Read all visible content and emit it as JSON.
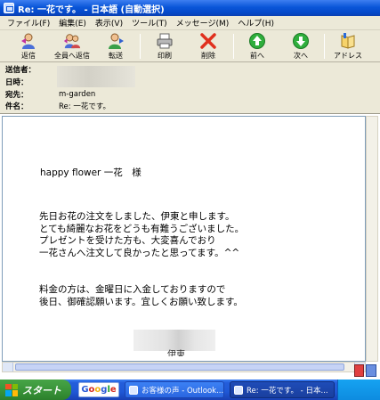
{
  "window": {
    "title": "Re: 一花です。 - 日本語 (自動選択)"
  },
  "menu": [
    {
      "label": "ファイル(F)"
    },
    {
      "label": "編集(E)"
    },
    {
      "label": "表示(V)"
    },
    {
      "label": "ツール(T)"
    },
    {
      "label": "メッセージ(M)"
    },
    {
      "label": "ヘルプ(H)"
    }
  ],
  "toolbar": {
    "reply": "返信",
    "reply_all": "全員へ返信",
    "forward": "転送",
    "print": "印刷",
    "delete": "削除",
    "previous": "前へ",
    "next": "次へ",
    "addresses": "アドレス"
  },
  "headers": {
    "from_label": "送信者：",
    "date_label": "日時：",
    "to_label": "宛先：",
    "to_value": "m-garden",
    "subject_label": "件名：",
    "subject_value": "Re: 一花です。"
  },
  "message": {
    "greeting": "happy flower 一花　様",
    "paragraph1": [
      "先日お花の注文をしました、伊東と申します。",
      "とても綺麗なお花をどうも有難うございました。",
      "プレゼントを受けた方も、大変喜んでおり",
      "一花さんへ注文して良かったと思ってます。^^"
    ],
    "paragraph2": [
      "料金の方は、金曜日に入金しておりますので",
      "後日、御確認願います。宜しくお願い致します。"
    ],
    "signature_partial": "伊東"
  },
  "taskbar": {
    "start": "スタート",
    "google": [
      "G",
      "o",
      "o",
      "g",
      "l",
      "e"
    ],
    "task1": "お客様の声 - Outlook...",
    "task2": "Re: 一花です。 - 日本..."
  },
  "colors": {
    "titlebar": "#0a56d8",
    "chrome": "#ece9d8",
    "taskbar": "#245edb",
    "start": "#3a953a"
  }
}
